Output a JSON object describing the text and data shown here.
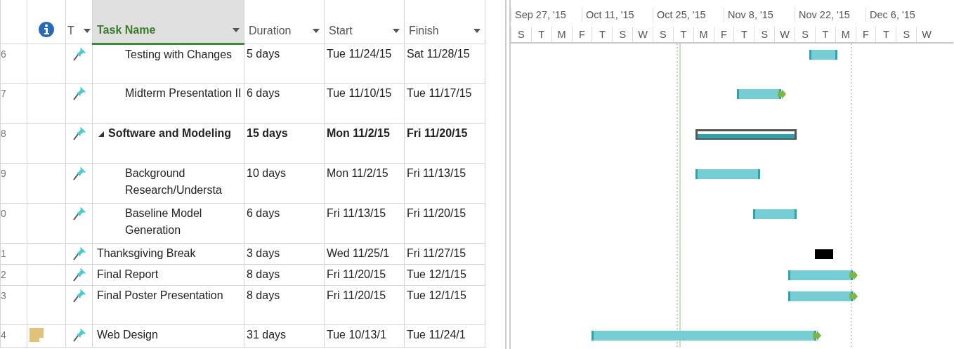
{
  "columns": [
    {
      "kind": "indicators"
    },
    {
      "kind": "mode",
      "label": "T",
      "selected": false
    },
    {
      "kind": "name",
      "label": "Task Name",
      "selected": true
    },
    {
      "kind": "duration",
      "label": "Duration",
      "selected": false
    },
    {
      "kind": "start",
      "label": "Start",
      "selected": false
    },
    {
      "kind": "finish",
      "label": "Finish",
      "selected": false
    }
  ],
  "tasks_above": [
    {
      "row_number": "6",
      "manual": true,
      "note": false,
      "name": "Testing with Changes",
      "duration": "5 days",
      "start": "Tue 11/24/15",
      "finish": "Sat 11/28/15",
      "kind": "task",
      "deadline_marker": false
    },
    {
      "row_number": "7",
      "manual": true,
      "note": false,
      "name": "Midterm Presentation II",
      "duration": "6 days",
      "start": "Tue 11/10/15",
      "finish": "Tue 11/17/15",
      "kind": "task",
      "deadline_marker": true
    }
  ],
  "tasks": [
    {
      "row_number": "8",
      "manual": true,
      "note": false,
      "name": "Software and Modeling",
      "duration": "15 days",
      "start": "Mon 11/2/15",
      "finish": "Fri 11/20/15",
      "kind": "summary",
      "deadline_marker": false,
      "expanded": true,
      "children": [
        {
          "row_number": "9",
          "manual": true,
          "note": false,
          "name": "Background Research/Understa",
          "duration": "10 days",
          "start": "Mon 11/2/15",
          "finish": "Fri 11/13/15",
          "kind": "task",
          "deadline_marker": false
        },
        {
          "row_number": "0",
          "manual": true,
          "note": false,
          "name": "Baseline Model Generation",
          "duration": "6 days",
          "start": "Fri 11/13/15",
          "finish": "Fri 11/20/15",
          "kind": "task",
          "deadline_marker": false
        }
      ]
    },
    {
      "row_number": "1",
      "manual": true,
      "note": false,
      "name": "Thanksgiving Break",
      "duration": "3 days",
      "start": "Wed 11/25/1",
      "finish": "Fri 11/27/15",
      "kind": "break",
      "deadline_marker": false
    },
    {
      "row_number": "2",
      "manual": true,
      "note": false,
      "name": "Final Report",
      "duration": "8 days",
      "start": "Fri 11/20/15",
      "finish": "Tue 12/1/15",
      "kind": "task",
      "deadline_marker": true
    },
    {
      "row_number": "3",
      "manual": true,
      "note": false,
      "name": "Final Poster Presentation",
      "duration": "8 days",
      "start": "Fri 11/20/15",
      "finish": "Tue 12/1/15",
      "kind": "task",
      "deadline_marker": true
    },
    {
      "row_number": "4",
      "manual": true,
      "note": true,
      "name": "Web Design",
      "duration": "31 days",
      "start": "Tue 10/13/1",
      "finish": "Tue 11/24/1",
      "kind": "task",
      "deadline_marker": true
    }
  ],
  "timescale": {
    "top": [
      "Sep 27, '15",
      "Oct 11, '15",
      "Oct 25, '15",
      "Nov 8, '15",
      "Nov 22, '15",
      "Dec 6, '15"
    ],
    "bottom": [
      "S",
      "T",
      "M",
      "F",
      "T",
      "S",
      "W",
      "S",
      "T",
      "M",
      "F",
      "T",
      "S",
      "W",
      "S",
      "T",
      "M",
      "F",
      "T",
      "S",
      "W"
    ]
  }
}
